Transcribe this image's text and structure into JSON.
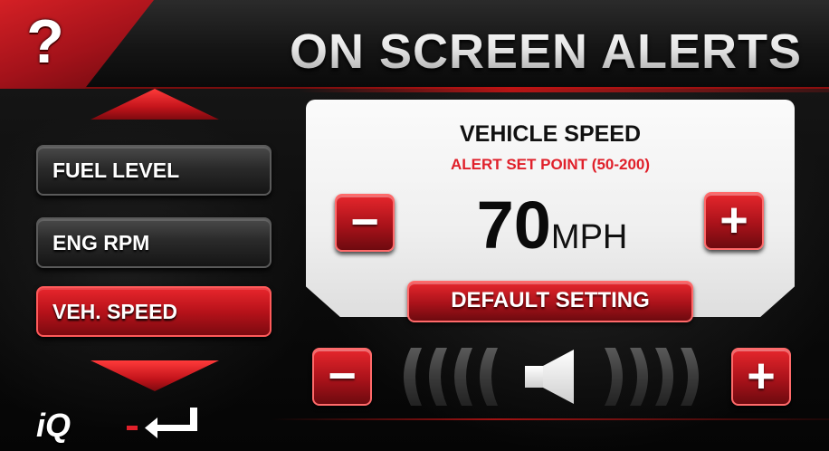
{
  "header": {
    "help_label": "?",
    "title": "ON SCREEN ALERTS"
  },
  "menu": {
    "items": [
      {
        "label": "FUEL LEVEL",
        "active": false
      },
      {
        "label": "ENG RPM",
        "active": false
      },
      {
        "label": "VEH. SPEED",
        "active": true
      }
    ],
    "scroll_up_icon": "triangle-up-icon",
    "scroll_down_icon": "triangle-down-icon"
  },
  "alert": {
    "name": "VEHICLE SPEED",
    "range_label": "ALERT SET POINT (50-200)",
    "value": "70",
    "unit": "MPH",
    "decrease_label": "−",
    "increase_label": "+",
    "default_button_label": "DEFAULT SETTING"
  },
  "volume": {
    "decrease_label": "−",
    "increase_label": "+",
    "icon": "speaker-icon"
  },
  "footer": {
    "logo": "iQ",
    "back_icon": "return-arrow-icon"
  },
  "colors": {
    "accent": "#c3141b",
    "panel": "#f2f2f2",
    "text_red": "#e0202a"
  }
}
